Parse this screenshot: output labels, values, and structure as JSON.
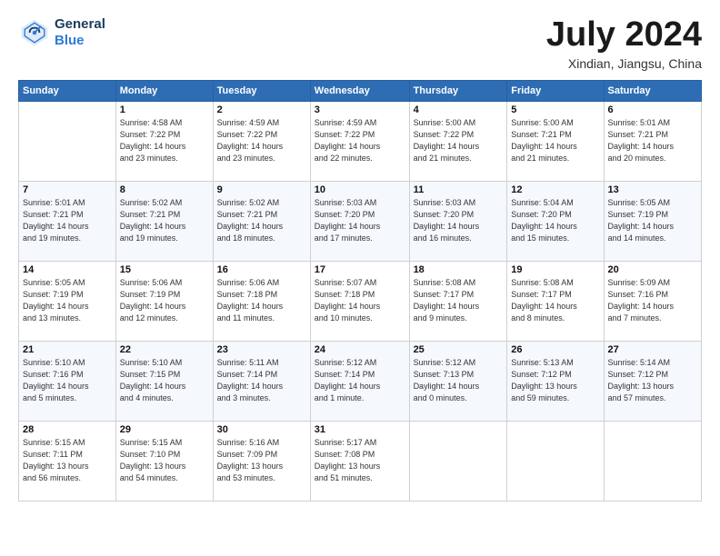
{
  "logo": {
    "line1": "General",
    "line2": "Blue"
  },
  "title": "July 2024",
  "location": "Xindian, Jiangsu, China",
  "days_header": [
    "Sunday",
    "Monday",
    "Tuesday",
    "Wednesday",
    "Thursday",
    "Friday",
    "Saturday"
  ],
  "weeks": [
    [
      {
        "day": "",
        "sunrise": "",
        "sunset": "",
        "daylight": ""
      },
      {
        "day": "1",
        "sunrise": "Sunrise: 4:58 AM",
        "sunset": "Sunset: 7:22 PM",
        "daylight": "Daylight: 14 hours and 23 minutes."
      },
      {
        "day": "2",
        "sunrise": "Sunrise: 4:59 AM",
        "sunset": "Sunset: 7:22 PM",
        "daylight": "Daylight: 14 hours and 23 minutes."
      },
      {
        "day": "3",
        "sunrise": "Sunrise: 4:59 AM",
        "sunset": "Sunset: 7:22 PM",
        "daylight": "Daylight: 14 hours and 22 minutes."
      },
      {
        "day": "4",
        "sunrise": "Sunrise: 5:00 AM",
        "sunset": "Sunset: 7:22 PM",
        "daylight": "Daylight: 14 hours and 21 minutes."
      },
      {
        "day": "5",
        "sunrise": "Sunrise: 5:00 AM",
        "sunset": "Sunset: 7:21 PM",
        "daylight": "Daylight: 14 hours and 21 minutes."
      },
      {
        "day": "6",
        "sunrise": "Sunrise: 5:01 AM",
        "sunset": "Sunset: 7:21 PM",
        "daylight": "Daylight: 14 hours and 20 minutes."
      }
    ],
    [
      {
        "day": "7",
        "sunrise": "Sunrise: 5:01 AM",
        "sunset": "Sunset: 7:21 PM",
        "daylight": "Daylight: 14 hours and 19 minutes."
      },
      {
        "day": "8",
        "sunrise": "Sunrise: 5:02 AM",
        "sunset": "Sunset: 7:21 PM",
        "daylight": "Daylight: 14 hours and 19 minutes."
      },
      {
        "day": "9",
        "sunrise": "Sunrise: 5:02 AM",
        "sunset": "Sunset: 7:21 PM",
        "daylight": "Daylight: 14 hours and 18 minutes."
      },
      {
        "day": "10",
        "sunrise": "Sunrise: 5:03 AM",
        "sunset": "Sunset: 7:20 PM",
        "daylight": "Daylight: 14 hours and 17 minutes."
      },
      {
        "day": "11",
        "sunrise": "Sunrise: 5:03 AM",
        "sunset": "Sunset: 7:20 PM",
        "daylight": "Daylight: 14 hours and 16 minutes."
      },
      {
        "day": "12",
        "sunrise": "Sunrise: 5:04 AM",
        "sunset": "Sunset: 7:20 PM",
        "daylight": "Daylight: 14 hours and 15 minutes."
      },
      {
        "day": "13",
        "sunrise": "Sunrise: 5:05 AM",
        "sunset": "Sunset: 7:19 PM",
        "daylight": "Daylight: 14 hours and 14 minutes."
      }
    ],
    [
      {
        "day": "14",
        "sunrise": "Sunrise: 5:05 AM",
        "sunset": "Sunset: 7:19 PM",
        "daylight": "Daylight: 14 hours and 13 minutes."
      },
      {
        "day": "15",
        "sunrise": "Sunrise: 5:06 AM",
        "sunset": "Sunset: 7:19 PM",
        "daylight": "Daylight: 14 hours and 12 minutes."
      },
      {
        "day": "16",
        "sunrise": "Sunrise: 5:06 AM",
        "sunset": "Sunset: 7:18 PM",
        "daylight": "Daylight: 14 hours and 11 minutes."
      },
      {
        "day": "17",
        "sunrise": "Sunrise: 5:07 AM",
        "sunset": "Sunset: 7:18 PM",
        "daylight": "Daylight: 14 hours and 10 minutes."
      },
      {
        "day": "18",
        "sunrise": "Sunrise: 5:08 AM",
        "sunset": "Sunset: 7:17 PM",
        "daylight": "Daylight: 14 hours and 9 minutes."
      },
      {
        "day": "19",
        "sunrise": "Sunrise: 5:08 AM",
        "sunset": "Sunset: 7:17 PM",
        "daylight": "Daylight: 14 hours and 8 minutes."
      },
      {
        "day": "20",
        "sunrise": "Sunrise: 5:09 AM",
        "sunset": "Sunset: 7:16 PM",
        "daylight": "Daylight: 14 hours and 7 minutes."
      }
    ],
    [
      {
        "day": "21",
        "sunrise": "Sunrise: 5:10 AM",
        "sunset": "Sunset: 7:16 PM",
        "daylight": "Daylight: 14 hours and 5 minutes."
      },
      {
        "day": "22",
        "sunrise": "Sunrise: 5:10 AM",
        "sunset": "Sunset: 7:15 PM",
        "daylight": "Daylight: 14 hours and 4 minutes."
      },
      {
        "day": "23",
        "sunrise": "Sunrise: 5:11 AM",
        "sunset": "Sunset: 7:14 PM",
        "daylight": "Daylight: 14 hours and 3 minutes."
      },
      {
        "day": "24",
        "sunrise": "Sunrise: 5:12 AM",
        "sunset": "Sunset: 7:14 PM",
        "daylight": "Daylight: 14 hours and 1 minute."
      },
      {
        "day": "25",
        "sunrise": "Sunrise: 5:12 AM",
        "sunset": "Sunset: 7:13 PM",
        "daylight": "Daylight: 14 hours and 0 minutes."
      },
      {
        "day": "26",
        "sunrise": "Sunrise: 5:13 AM",
        "sunset": "Sunset: 7:12 PM",
        "daylight": "Daylight: 13 hours and 59 minutes."
      },
      {
        "day": "27",
        "sunrise": "Sunrise: 5:14 AM",
        "sunset": "Sunset: 7:12 PM",
        "daylight": "Daylight: 13 hours and 57 minutes."
      }
    ],
    [
      {
        "day": "28",
        "sunrise": "Sunrise: 5:15 AM",
        "sunset": "Sunset: 7:11 PM",
        "daylight": "Daylight: 13 hours and 56 minutes."
      },
      {
        "day": "29",
        "sunrise": "Sunrise: 5:15 AM",
        "sunset": "Sunset: 7:10 PM",
        "daylight": "Daylight: 13 hours and 54 minutes."
      },
      {
        "day": "30",
        "sunrise": "Sunrise: 5:16 AM",
        "sunset": "Sunset: 7:09 PM",
        "daylight": "Daylight: 13 hours and 53 minutes."
      },
      {
        "day": "31",
        "sunrise": "Sunrise: 5:17 AM",
        "sunset": "Sunset: 7:08 PM",
        "daylight": "Daylight: 13 hours and 51 minutes."
      },
      {
        "day": "",
        "sunrise": "",
        "sunset": "",
        "daylight": ""
      },
      {
        "day": "",
        "sunrise": "",
        "sunset": "",
        "daylight": ""
      },
      {
        "day": "",
        "sunrise": "",
        "sunset": "",
        "daylight": ""
      }
    ]
  ]
}
